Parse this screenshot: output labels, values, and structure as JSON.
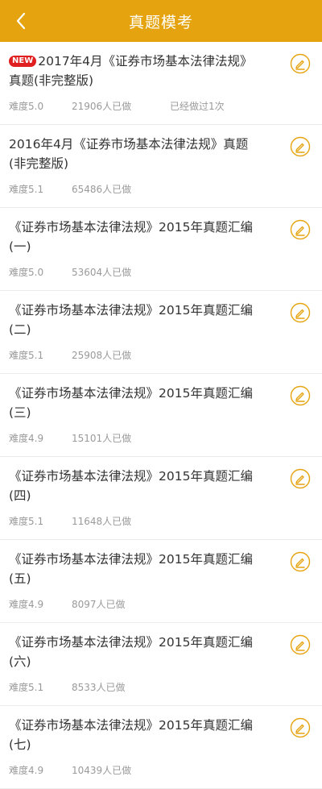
{
  "header": {
    "title": "真题模考"
  },
  "colors": {
    "accent": "#e5a40f",
    "badge": "#e02020"
  },
  "items": [
    {
      "new_label": "NEW",
      "line1": "2017年4月《证券市场基本法律法规》",
      "line2": "真题(非完整版)",
      "difficulty": "难度5.0",
      "count": "21906人已做",
      "status": "已经做过1次"
    },
    {
      "new_label": "",
      "line1": "2016年4月《证券市场基本法律法规》真题",
      "line2": "(非完整版)",
      "difficulty": "难度5.1",
      "count": "65486人已做",
      "status": ""
    },
    {
      "new_label": "",
      "line1": "《证券市场基本法律法规》2015年真题汇编",
      "line2": "(一)",
      "difficulty": "难度5.0",
      "count": "53604人已做",
      "status": ""
    },
    {
      "new_label": "",
      "line1": "《证券市场基本法律法规》2015年真题汇编",
      "line2": "(二)",
      "difficulty": "难度5.1",
      "count": "25908人已做",
      "status": ""
    },
    {
      "new_label": "",
      "line1": "《证券市场基本法律法规》2015年真题汇编",
      "line2": "(三)",
      "difficulty": "难度4.9",
      "count": "15101人已做",
      "status": ""
    },
    {
      "new_label": "",
      "line1": "《证券市场基本法律法规》2015年真题汇编",
      "line2": "(四)",
      "difficulty": "难度5.1",
      "count": "11648人已做",
      "status": ""
    },
    {
      "new_label": "",
      "line1": "《证券市场基本法律法规》2015年真题汇编",
      "line2": "(五)",
      "difficulty": "难度4.9",
      "count": "8097人已做",
      "status": ""
    },
    {
      "new_label": "",
      "line1": "《证券市场基本法律法规》2015年真题汇编",
      "line2": "(六)",
      "difficulty": "难度5.1",
      "count": "8533人已做",
      "status": ""
    },
    {
      "new_label": "",
      "line1": "《证券市场基本法律法规》2015年真题汇编",
      "line2": "(七)",
      "difficulty": "难度4.9",
      "count": "10439人已做",
      "status": ""
    }
  ]
}
